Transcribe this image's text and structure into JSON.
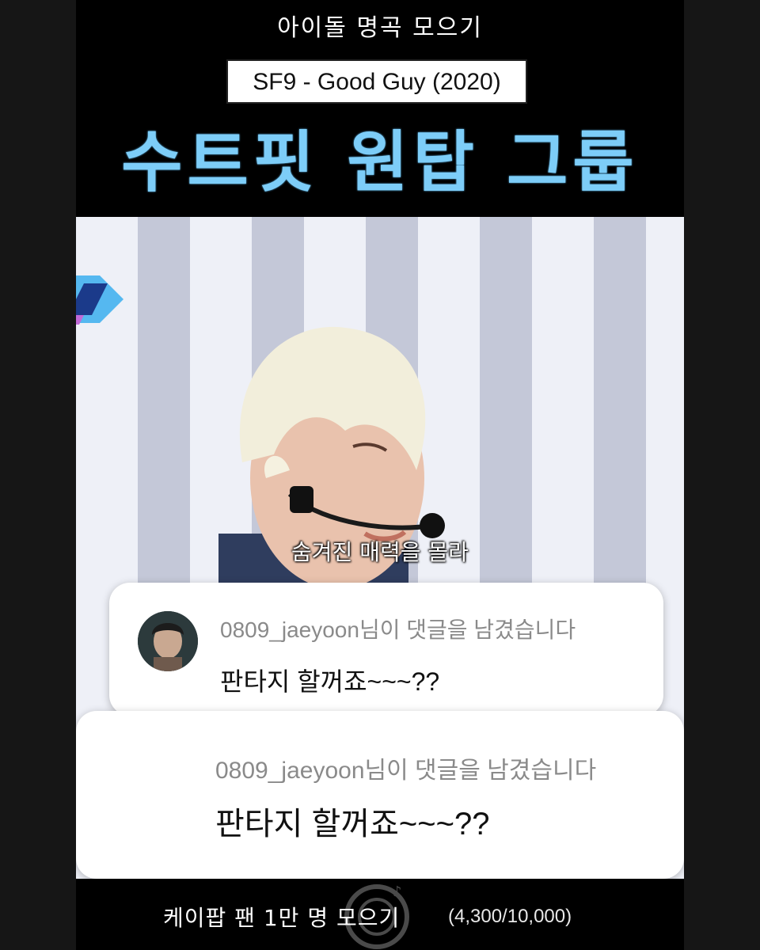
{
  "header": {
    "channel_title": "아이돌 명곡 모으기",
    "song": "SF9 - Good Guy (2020)",
    "headline": "수트핏 원탑 그룹"
  },
  "video": {
    "lyric": "숨겨진 매력을 몰라"
  },
  "comments": [
    {
      "meta": "0809_jaeyoon님이 댓글을 남겼습니다",
      "text": "판타지 할꺼죠~~~??"
    },
    {
      "meta": "0809_jaeyoon님이 댓글을 남겼습니다",
      "text": "판타지 할꺼죠~~~??"
    }
  ],
  "footer": {
    "goal_label": "케이팝 팬 1만 명 모으기",
    "goal_count": "(4,300/10,000)",
    "goal_progress": 0.43
  },
  "colors": {
    "headline": "#7dcdf8",
    "background": "#000000",
    "card": "#ffffff",
    "meta_text": "#8a8a8a"
  }
}
